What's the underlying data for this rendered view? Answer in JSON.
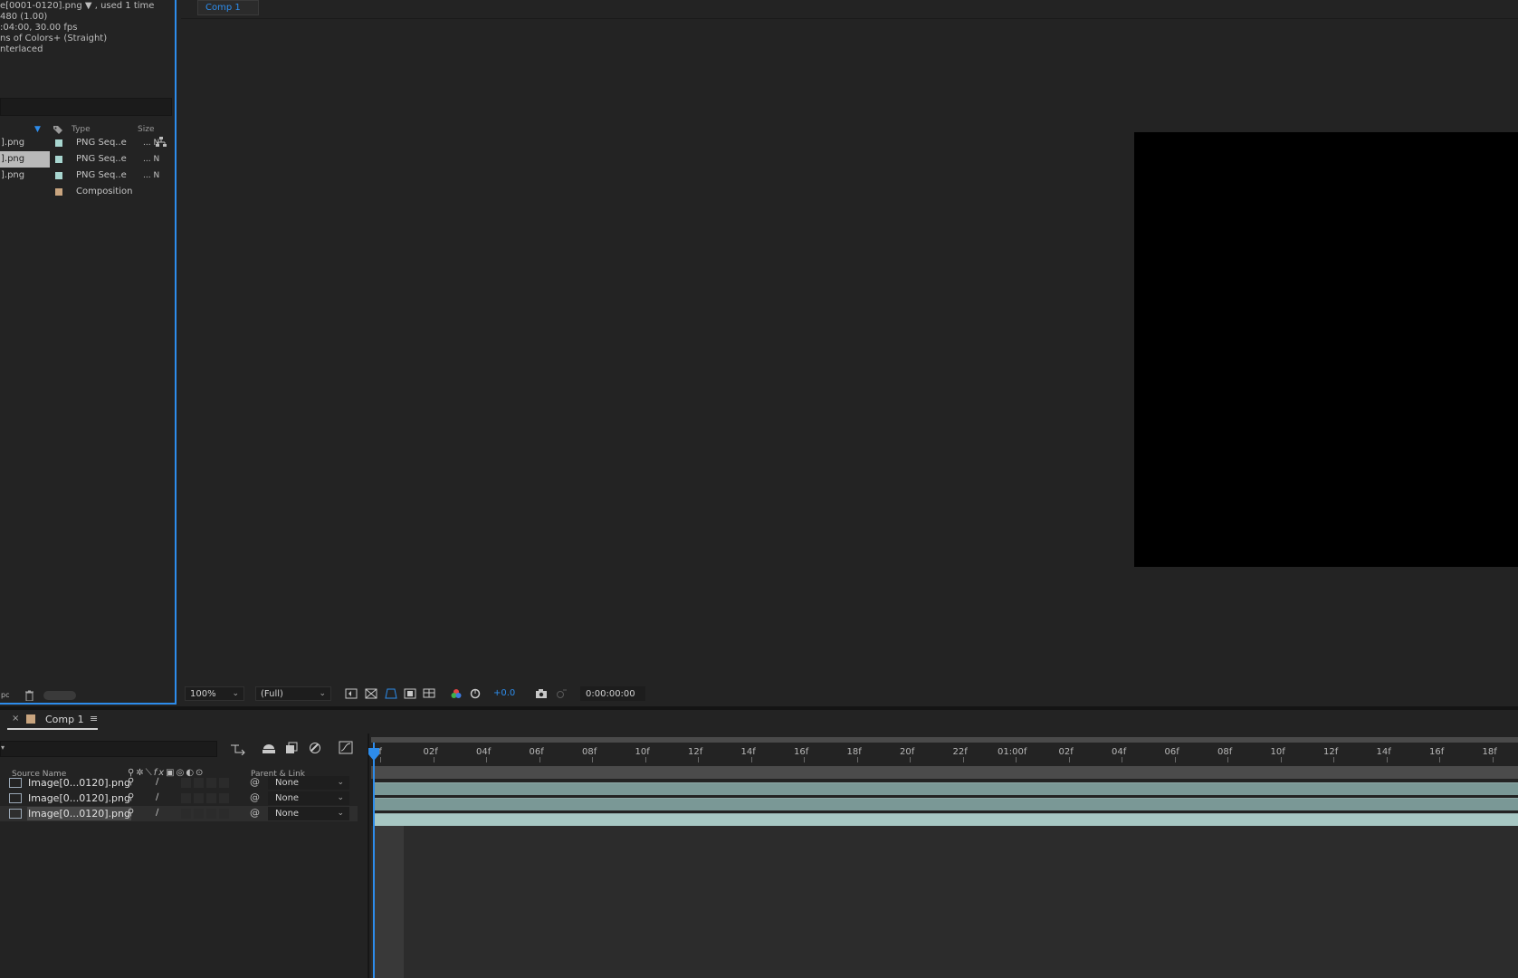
{
  "project": {
    "info_lines": [
      "e[0001-0120].png ▼ , used 1 time",
      "480 (1.00)",
      ":04:00, 30.00 fps",
      "ns of Colors+ (Straight)",
      "nterlaced"
    ],
    "headers": {
      "type": "Type",
      "size": "Size"
    },
    "rows": [
      {
        "name": "].png",
        "type": "PNG Seq..e",
        "size": "... N",
        "color": "#a8d6d0",
        "selected": false
      },
      {
        "name": "].png",
        "type": "PNG Seq..e",
        "size": "... N",
        "color": "#a8d6d0",
        "selected": true
      },
      {
        "name": "].png",
        "type": "PNG Seq..e",
        "size": "... N",
        "color": "#a8d6d0",
        "selected": false
      },
      {
        "name": "",
        "type": "Composition",
        "size": "",
        "color": "#c9a57f",
        "selected": false
      }
    ],
    "footer": {
      "bpc": "pc"
    }
  },
  "viewer": {
    "tab_label": "Comp 1",
    "zoom": "100%",
    "resolution": "(Full)",
    "exposure": "+0.0",
    "timecode": "0:00:00:00"
  },
  "timeline": {
    "tab_label": "Comp 1",
    "columns": {
      "source_name": "Source Name",
      "parent_link": "Parent & Link"
    },
    "ruler_ticks": [
      "0f",
      "02f",
      "04f",
      "06f",
      "08f",
      "10f",
      "12f",
      "14f",
      "16f",
      "18f",
      "20f",
      "22f",
      "01:00f",
      "02f",
      "04f",
      "06f",
      "08f",
      "10f",
      "12f",
      "14f",
      "16f",
      "18f"
    ],
    "layers": [
      {
        "name": "Image[0...0120].png",
        "parent": "None",
        "selected": false
      },
      {
        "name": "Image[0...0120].png",
        "parent": "None",
        "selected": false
      },
      {
        "name": "Image[0...0120].png",
        "parent": "None",
        "selected": true
      }
    ]
  },
  "colors": {
    "accent": "#2d8ceb",
    "background": "#232323",
    "track": "#7a9896"
  }
}
